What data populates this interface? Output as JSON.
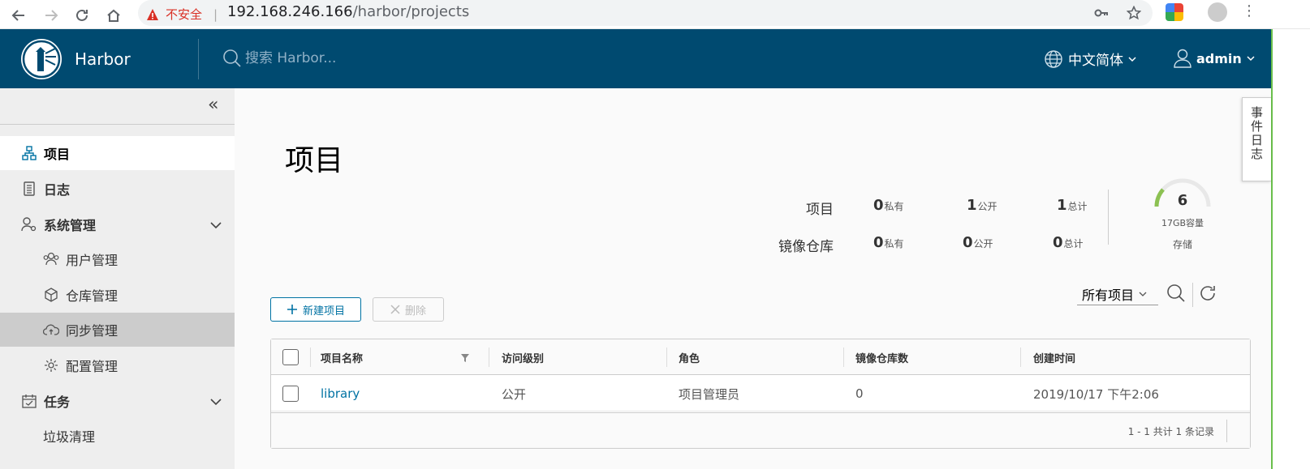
{
  "browser": {
    "warning": "不安全",
    "url_host": "192.168.246.166",
    "url_path": "/harbor/projects"
  },
  "header": {
    "app_title": "Harbor",
    "search_placeholder": "搜索 Harbor...",
    "language": "中文简体",
    "user": "admin"
  },
  "sidebar": {
    "items": [
      {
        "label": "项目"
      },
      {
        "label": "日志"
      },
      {
        "label": "系统管理"
      },
      {
        "label": "用户管理"
      },
      {
        "label": "仓库管理"
      },
      {
        "label": "同步管理"
      },
      {
        "label": "配置管理"
      },
      {
        "label": "任务"
      },
      {
        "label": "垃圾清理"
      }
    ]
  },
  "main": {
    "title": "项目",
    "stats": {
      "projects_label": "项目",
      "repos_label": "镜像仓库",
      "private_unit": "私有",
      "public_unit": "公开",
      "total_unit": "总计",
      "projects": {
        "private": "0",
        "public": "1",
        "total": "1"
      },
      "repos": {
        "private": "0",
        "public": "0",
        "total": "0"
      }
    },
    "storage": {
      "count": "6",
      "capacity": "17GB容量",
      "label": "存储"
    },
    "toolbar": {
      "new_project": "新建项目",
      "delete": "删除",
      "filter": "所有项目"
    },
    "grid": {
      "columns": [
        "项目名称",
        "访问级别",
        "角色",
        "镜像仓库数",
        "创建时间"
      ],
      "rows": [
        [
          "library",
          "公开",
          "项目管理员",
          "0",
          "2019/10/17 下午2:06"
        ]
      ],
      "footer": "1 - 1 共计 1 条记录"
    },
    "event_log": "事件日志"
  },
  "colors": {
    "header_bg": "#004a70",
    "link": "#0072a3",
    "gauge": "#8cc152"
  }
}
